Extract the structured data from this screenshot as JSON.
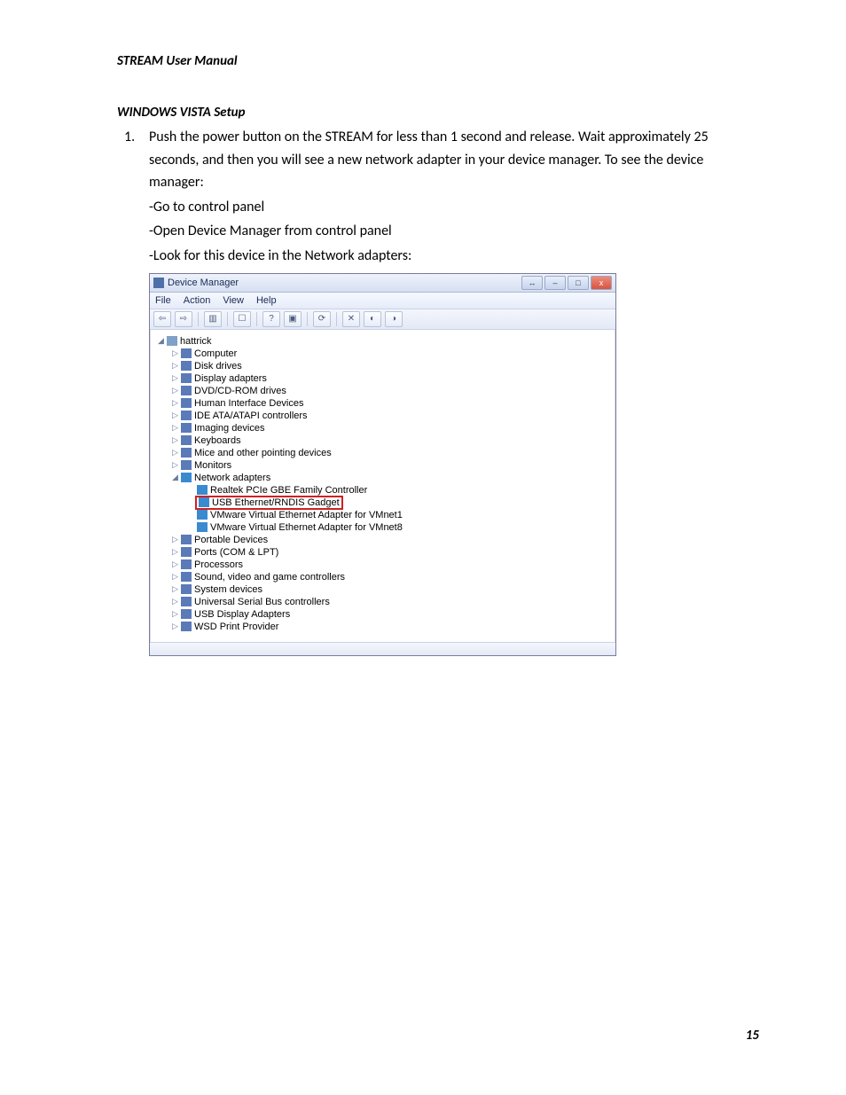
{
  "doc": {
    "header": "STREAM User Manual",
    "section_title": "WINDOWS VISTA Setup",
    "step_number": "1.",
    "step_text": "Push the power button on the STREAM for less than 1 second and release. Wait approximately 25 seconds, and then you will see a new network adapter in your device manager.  To see the device manager:",
    "sub1": "-Go to control panel",
    "sub2": "-Open Device Manager from control panel",
    "sub3": "-Look for this device in the Network adapters:",
    "page_number": "15"
  },
  "dm": {
    "title": "Device Manager",
    "menu": {
      "file": "File",
      "action": "Action",
      "view": "View",
      "help": "Help"
    },
    "win": {
      "resize": "↔",
      "min": "–",
      "max": "□",
      "close": "x"
    },
    "root": "hattrick",
    "cats": {
      "computer": "Computer",
      "disk": "Disk drives",
      "display": "Display adapters",
      "dvd": "DVD/CD-ROM drives",
      "hid": "Human Interface Devices",
      "ide": "IDE ATA/ATAPI controllers",
      "imaging": "Imaging devices",
      "keyboards": "Keyboards",
      "mice": "Mice and other pointing devices",
      "monitors": "Monitors",
      "network": "Network adapters",
      "portable": "Portable Devices",
      "ports": "Ports (COM & LPT)",
      "processors": "Processors",
      "sound": "Sound, video and game controllers",
      "system": "System devices",
      "usb_ctrl": "Universal Serial Bus controllers",
      "usb_disp": "USB Display Adapters",
      "wsd": "WSD Print Provider"
    },
    "net": {
      "realtek": "Realtek PCIe GBE Family Controller",
      "rndis": "USB Ethernet/RNDIS Gadget",
      "vmnet1": "VMware Virtual Ethernet Adapter for VMnet1",
      "vmnet8": "VMware Virtual Ethernet Adapter for VMnet8"
    }
  }
}
